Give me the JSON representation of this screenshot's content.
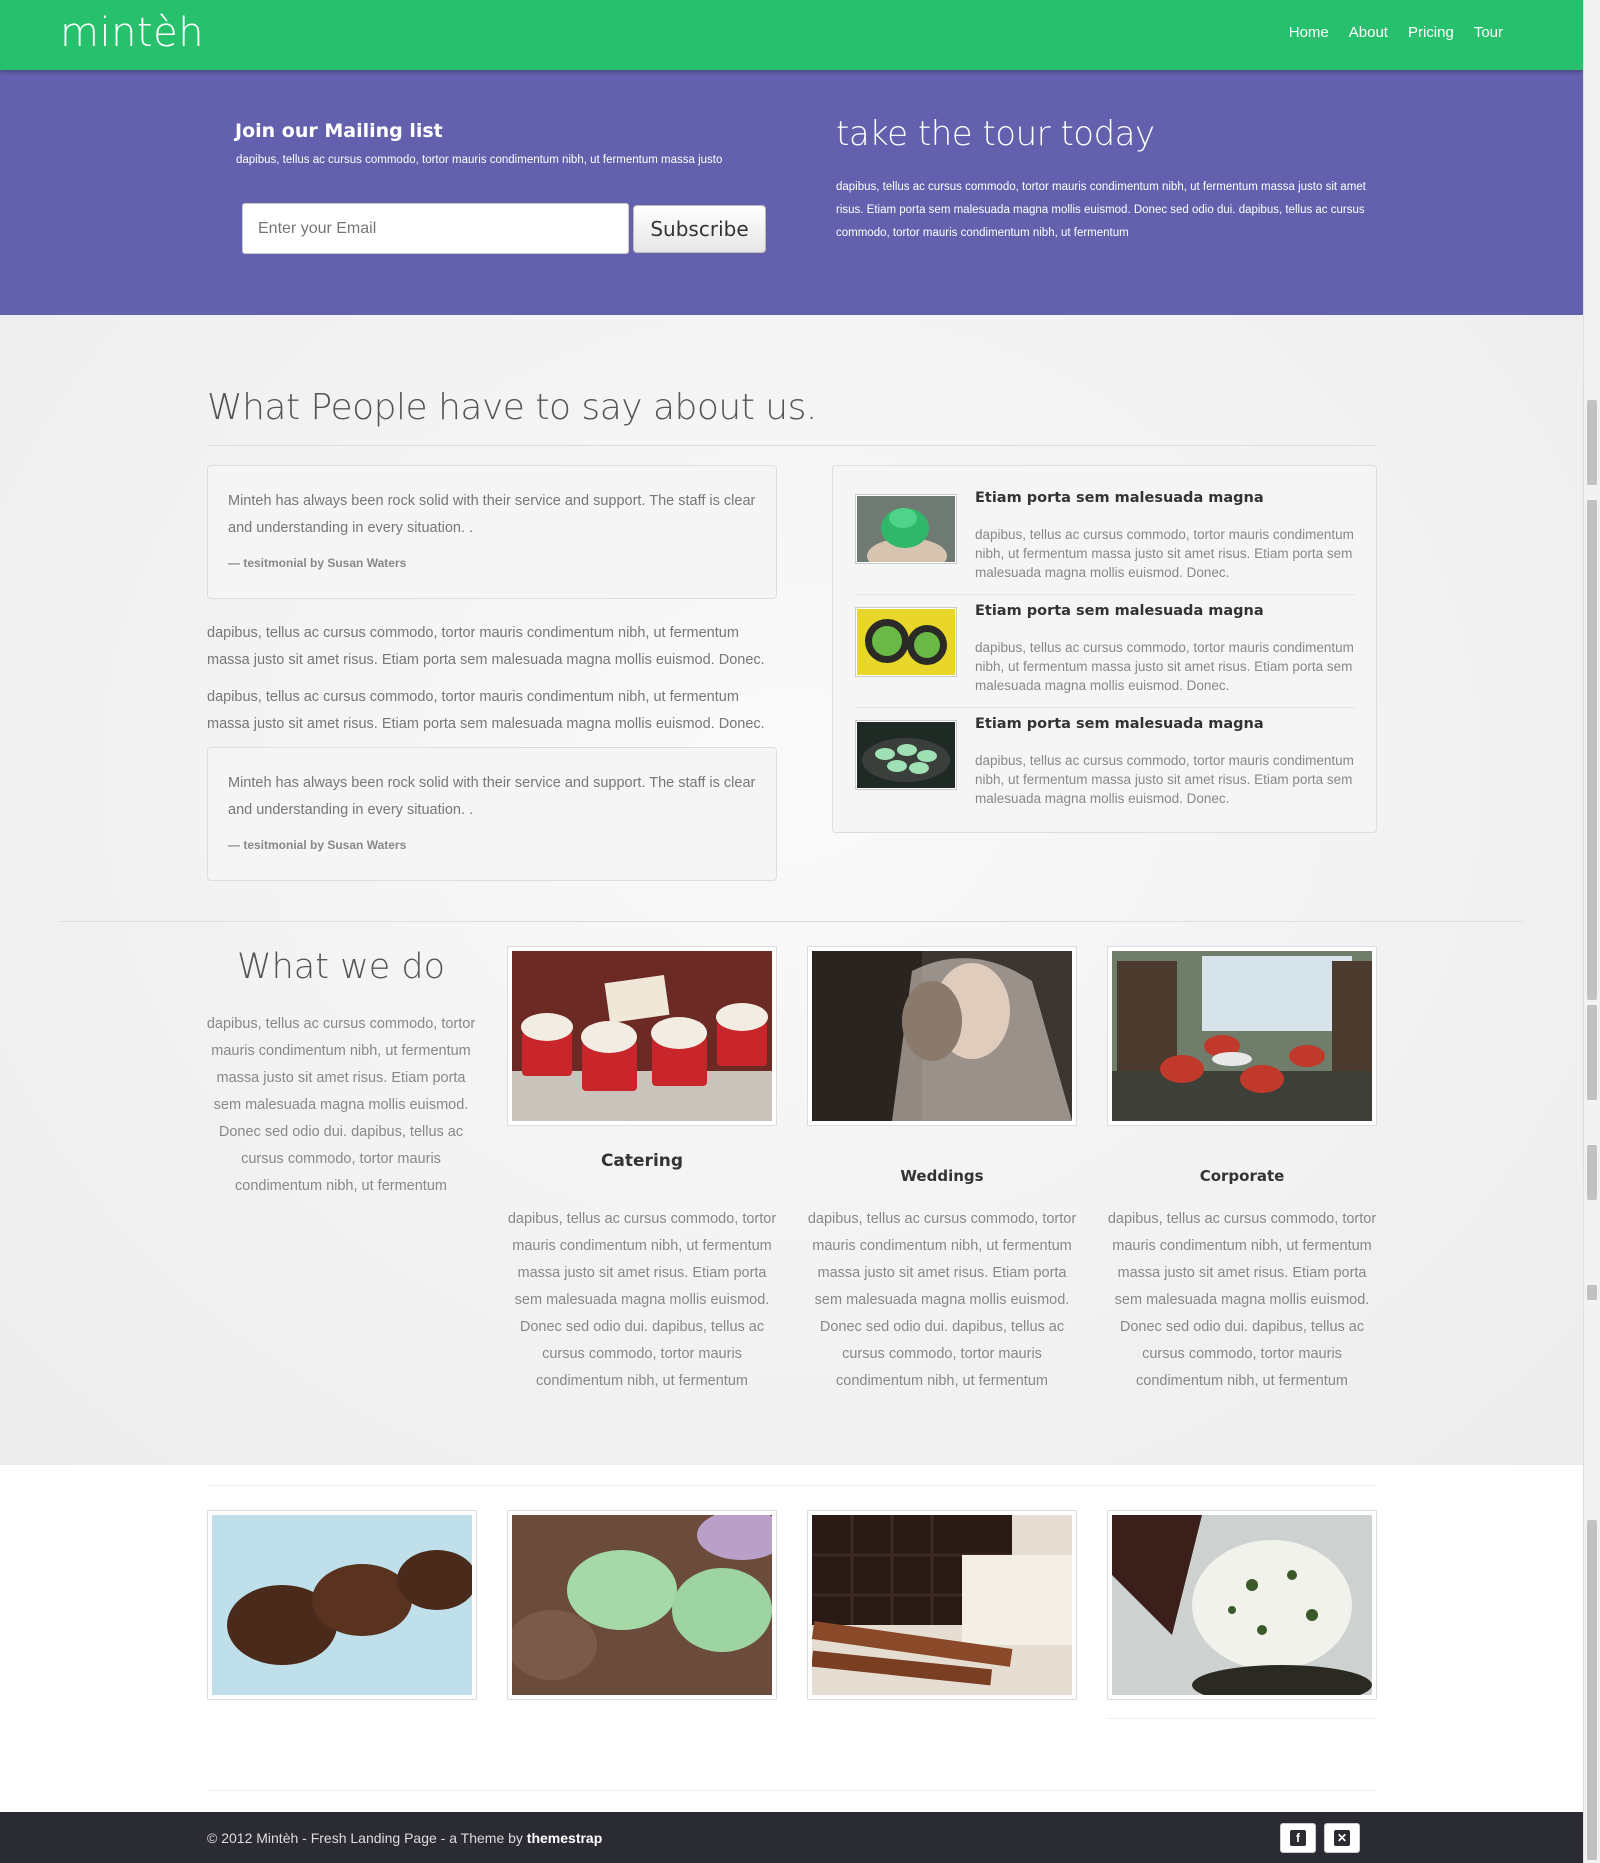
{
  "header": {
    "brand": "mintèh",
    "nav": [
      "Home",
      "About",
      "Pricing",
      "Tour"
    ]
  },
  "mailing": {
    "title": "Join our Mailing list",
    "subtitle": "dapibus, tellus ac cursus commodo, tortor mauris condimentum nibh, ut fermentum massa justo",
    "email_placeholder": "Enter your Email",
    "subscribe_label": "Subscribe"
  },
  "tour": {
    "title": "take the tour today",
    "text": "dapibus, tellus ac cursus commodo, tortor mauris condimentum nibh, ut fermentum massa justo sit amet risus. Etiam porta sem malesuada magna mollis euismod. Donec sed odio dui. dapibus, tellus ac cursus commodo, tortor mauris condimentum nibh, ut fermentum"
  },
  "testimonials": {
    "title": "What People have to say about us.",
    "quotes": [
      {
        "text": "Minteh has always been rock solid with their service and support. The staff is clear and understanding in every situation. .",
        "by": "— tesitmonial by Susan Waters"
      },
      {
        "text": "Minteh has always been rock solid with their service and support. The staff is clear and understanding in every situation. .",
        "by": "— tesitmonial by Susan Waters"
      }
    ],
    "paragraphs": [
      "dapibus, tellus ac cursus commodo, tortor mauris condimentum nibh, ut fermentum massa justo sit amet risus. Etiam porta sem malesuada magna mollis euismod. Donec.",
      "dapibus, tellus ac cursus commodo, tortor mauris condimentum nibh, ut fermentum massa justo sit amet risus. Etiam porta sem malesuada magna mollis euismod. Donec."
    ],
    "media": [
      {
        "heading": "Etiam porta sem malesuada magna",
        "text": "dapibus, tellus ac cursus commodo, tortor mauris condimentum nibh, ut fermentum massa justo sit amet risus. Etiam porta sem malesuada magna mollis euismod. Donec."
      },
      {
        "heading": "Etiam porta sem malesuada magna",
        "text": "dapibus, tellus ac cursus commodo, tortor mauris condimentum nibh, ut fermentum massa justo sit amet risus. Etiam porta sem malesuada magna mollis euismod. Donec."
      },
      {
        "heading": "Etiam porta sem malesuada magna",
        "text": "dapibus, tellus ac cursus commodo, tortor mauris condimentum nibh, ut fermentum massa justo sit amet risus. Etiam porta sem malesuada magna mollis euismod. Donec."
      }
    ]
  },
  "what_we_do": {
    "title": "What we do",
    "text": "dapibus, tellus ac cursus commodo, tortor mauris condimentum nibh, ut fermentum massa justo sit amet risus. Etiam porta sem malesuada magna mollis euismod. Donec sed odio dui. dapibus, tellus ac cursus commodo, tortor mauris condimentum nibh, ut fermentum",
    "services": [
      {
        "title": "Catering",
        "text": "dapibus, tellus ac cursus commodo, tortor mauris condimentum nibh, ut fermentum massa justo sit amet risus. Etiam porta sem malesuada magna mollis euismod. Donec sed odio dui. dapibus, tellus ac cursus commodo, tortor mauris condimentum nibh, ut fermentum"
      },
      {
        "title": "Weddings",
        "text": "dapibus, tellus ac cursus commodo, tortor mauris condimentum nibh, ut fermentum massa justo sit amet risus. Etiam porta sem malesuada magna mollis euismod. Donec sed odio dui. dapibus, tellus ac cursus commodo, tortor mauris condimentum nibh, ut fermentum"
      },
      {
        "title": "Corporate",
        "text": "dapibus, tellus ac cursus commodo, tortor mauris condimentum nibh, ut fermentum massa justo sit amet risus. Etiam porta sem malesuada magna mollis euismod. Donec sed odio dui. dapibus, tellus ac cursus commodo, tortor mauris condimentum nibh, ut fermentum"
      }
    ]
  },
  "footer": {
    "copyright_prefix": "© 2012 Mintèh - Fresh Landing Page - a Theme by ",
    "brand": "themestrap",
    "social": [
      "facebook-icon",
      "twitter-icon"
    ]
  },
  "colors": {
    "topbar": "#27c16d",
    "hero": "#6360ad",
    "footer": "#2b2b33"
  }
}
